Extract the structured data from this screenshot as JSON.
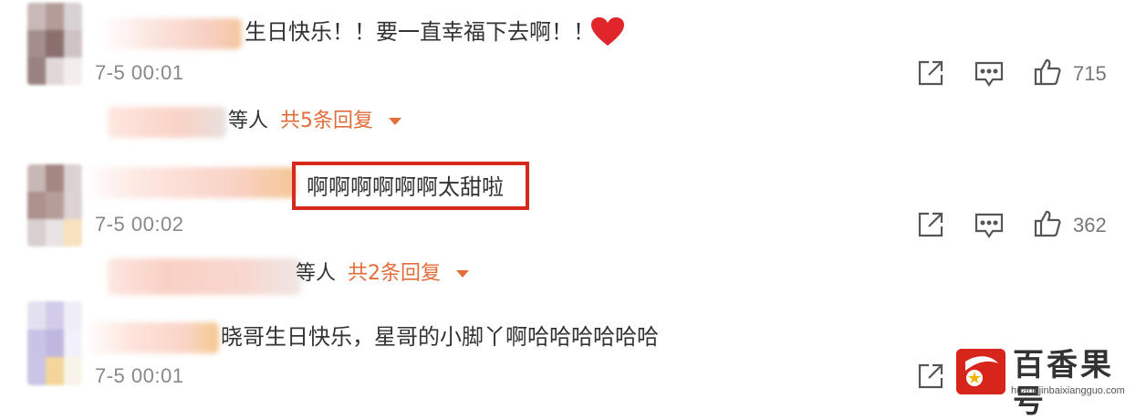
{
  "comments": [
    {
      "text": "生日快乐！！要一直幸福下去啊！！",
      "time": "7-5 00:01",
      "likes": "715",
      "replies": {
        "who": "等人",
        "count": "共5条回复"
      }
    },
    {
      "text": "啊啊啊啊啊啊太甜啦",
      "time": "7-5 00:02",
      "likes": "362",
      "replies": {
        "who": "等人",
        "count": "共2条回复"
      }
    },
    {
      "text": "晓哥生日快乐，星哥的小脚丫啊哈哈哈哈哈哈",
      "time": "7-5 00:01"
    }
  ],
  "watermark": {
    "title": "百香果号",
    "url": "huangjinbaixiangguo.com"
  },
  "colors": {
    "accent": "#e16d3b",
    "highlight_box": "#d7281e",
    "heart": "#e0262a"
  },
  "icons": [
    "share-icon",
    "comment-icon",
    "thumb-up-icon",
    "heart-icon",
    "caret-down-icon"
  ]
}
